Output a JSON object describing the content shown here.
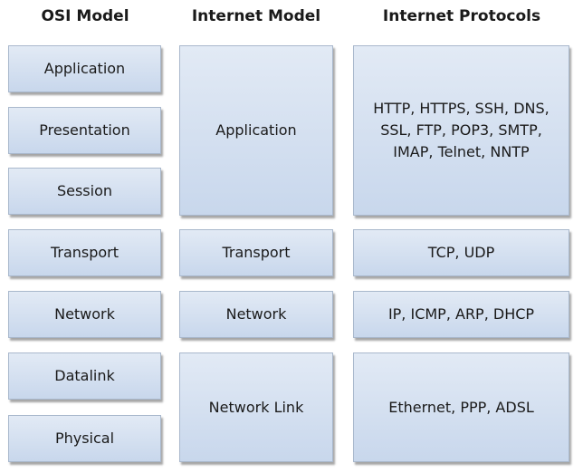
{
  "headers": {
    "osi": "OSI Model",
    "internet": "Internet Model",
    "protocols": "Internet Protocols"
  },
  "osi_layers": [
    "Application",
    "Presentation",
    "Session",
    "Transport",
    "Network",
    "Datalink",
    "Physical"
  ],
  "internet_layers": [
    "Application",
    "Transport",
    "Network",
    "Network Link"
  ],
  "protocols": [
    "HTTP, HTTPS, SSH, DNS, SSL, FTP, POP3, SMTP, IMAP, Telnet, NNTP",
    "TCP, UDP",
    "IP, ICMP, ARP, DHCP",
    "Ethernet, PPP, ADSL"
  ]
}
